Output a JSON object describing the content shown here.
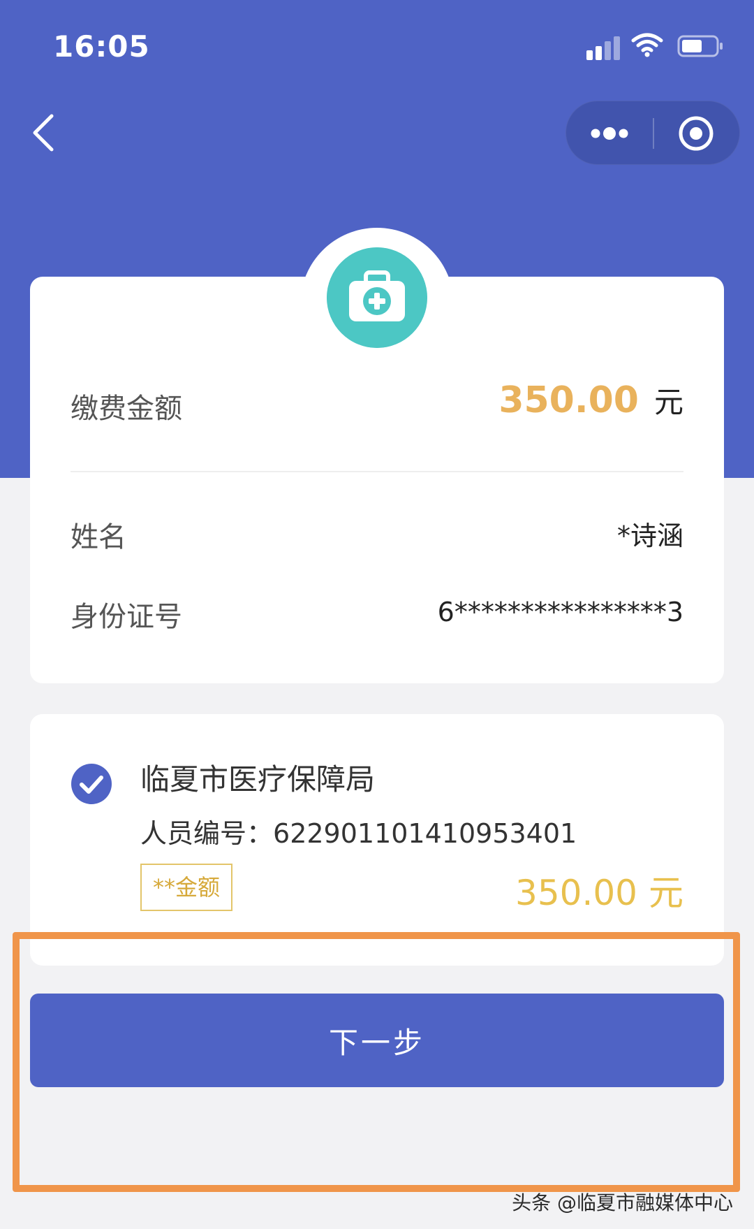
{
  "status_bar": {
    "time": "16:05"
  },
  "payment": {
    "amount_label": "缴费金额",
    "amount": "350.00",
    "unit": "元",
    "name_label": "姓名",
    "name_value": "*诗涵",
    "id_label": "身份证号",
    "id_value": "6****************3"
  },
  "payee": {
    "org": "临夏市医疗保障局",
    "person_label": "人员编号：",
    "person_number": "622901101410953401",
    "tag": "**金额",
    "amount": "350.00",
    "unit": "元"
  },
  "next_button": {
    "label": "下一步"
  },
  "watermark": "头条 @临夏市融媒体中心",
  "colors": {
    "primary": "#4f63c5",
    "amount": "#e9b25c",
    "icon_teal": "#4cc7c4",
    "highlight": "#f0954a"
  },
  "icons": [
    "back-icon",
    "more-icon",
    "close-target-icon",
    "medical-kit-icon",
    "check-icon",
    "signal-icon",
    "wifi-icon",
    "battery-icon"
  ]
}
